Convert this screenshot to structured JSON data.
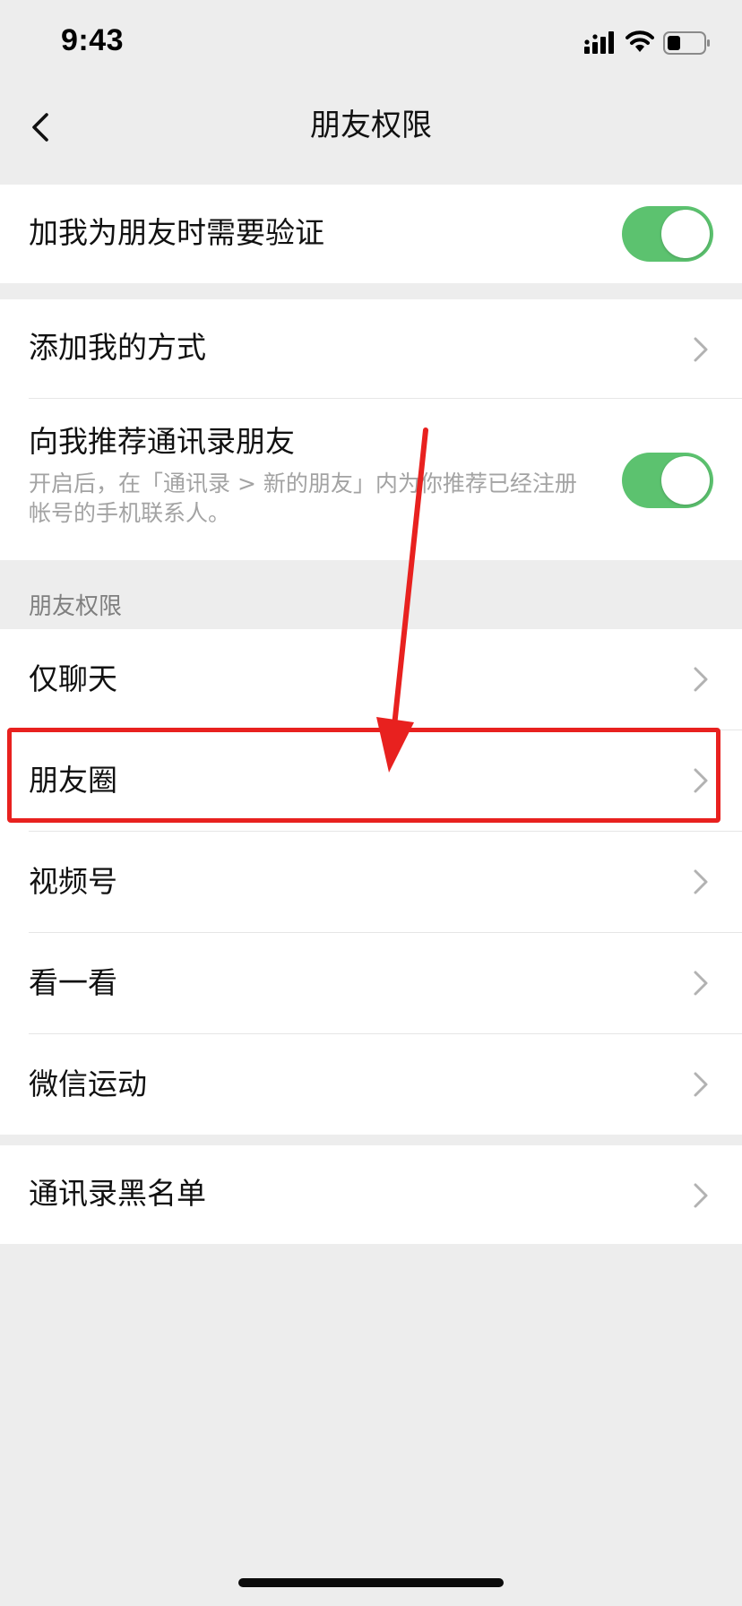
{
  "status_bar": {
    "time": "9:43",
    "icons": [
      "signal-icon",
      "wifi-icon",
      "battery-icon"
    ]
  },
  "nav": {
    "title": "朋友权限",
    "back_icon": "back-icon"
  },
  "verify_group": {
    "label": "加我为朋友时需要验证",
    "toggle_on": true
  },
  "add_group": {
    "add_methods_label": "添加我的方式",
    "recommend_label": "向我推荐通讯录朋友",
    "recommend_desc": "开启后，在「通讯录 > 新的朋友」内为你推荐已经注册帐号的手机联系人。",
    "recommend_toggle_on": true
  },
  "permissions": {
    "section_header": "朋友权限",
    "items": [
      {
        "label": "仅聊天"
      },
      {
        "label": "朋友圈"
      },
      {
        "label": "视频号"
      },
      {
        "label": "看一看"
      },
      {
        "label": "微信运动"
      }
    ]
  },
  "blacklist": {
    "label": "通讯录黑名单"
  },
  "colors": {
    "toggle_on": "#5cc26f",
    "annotation_red": "#e8211f",
    "background": "#ededed"
  }
}
